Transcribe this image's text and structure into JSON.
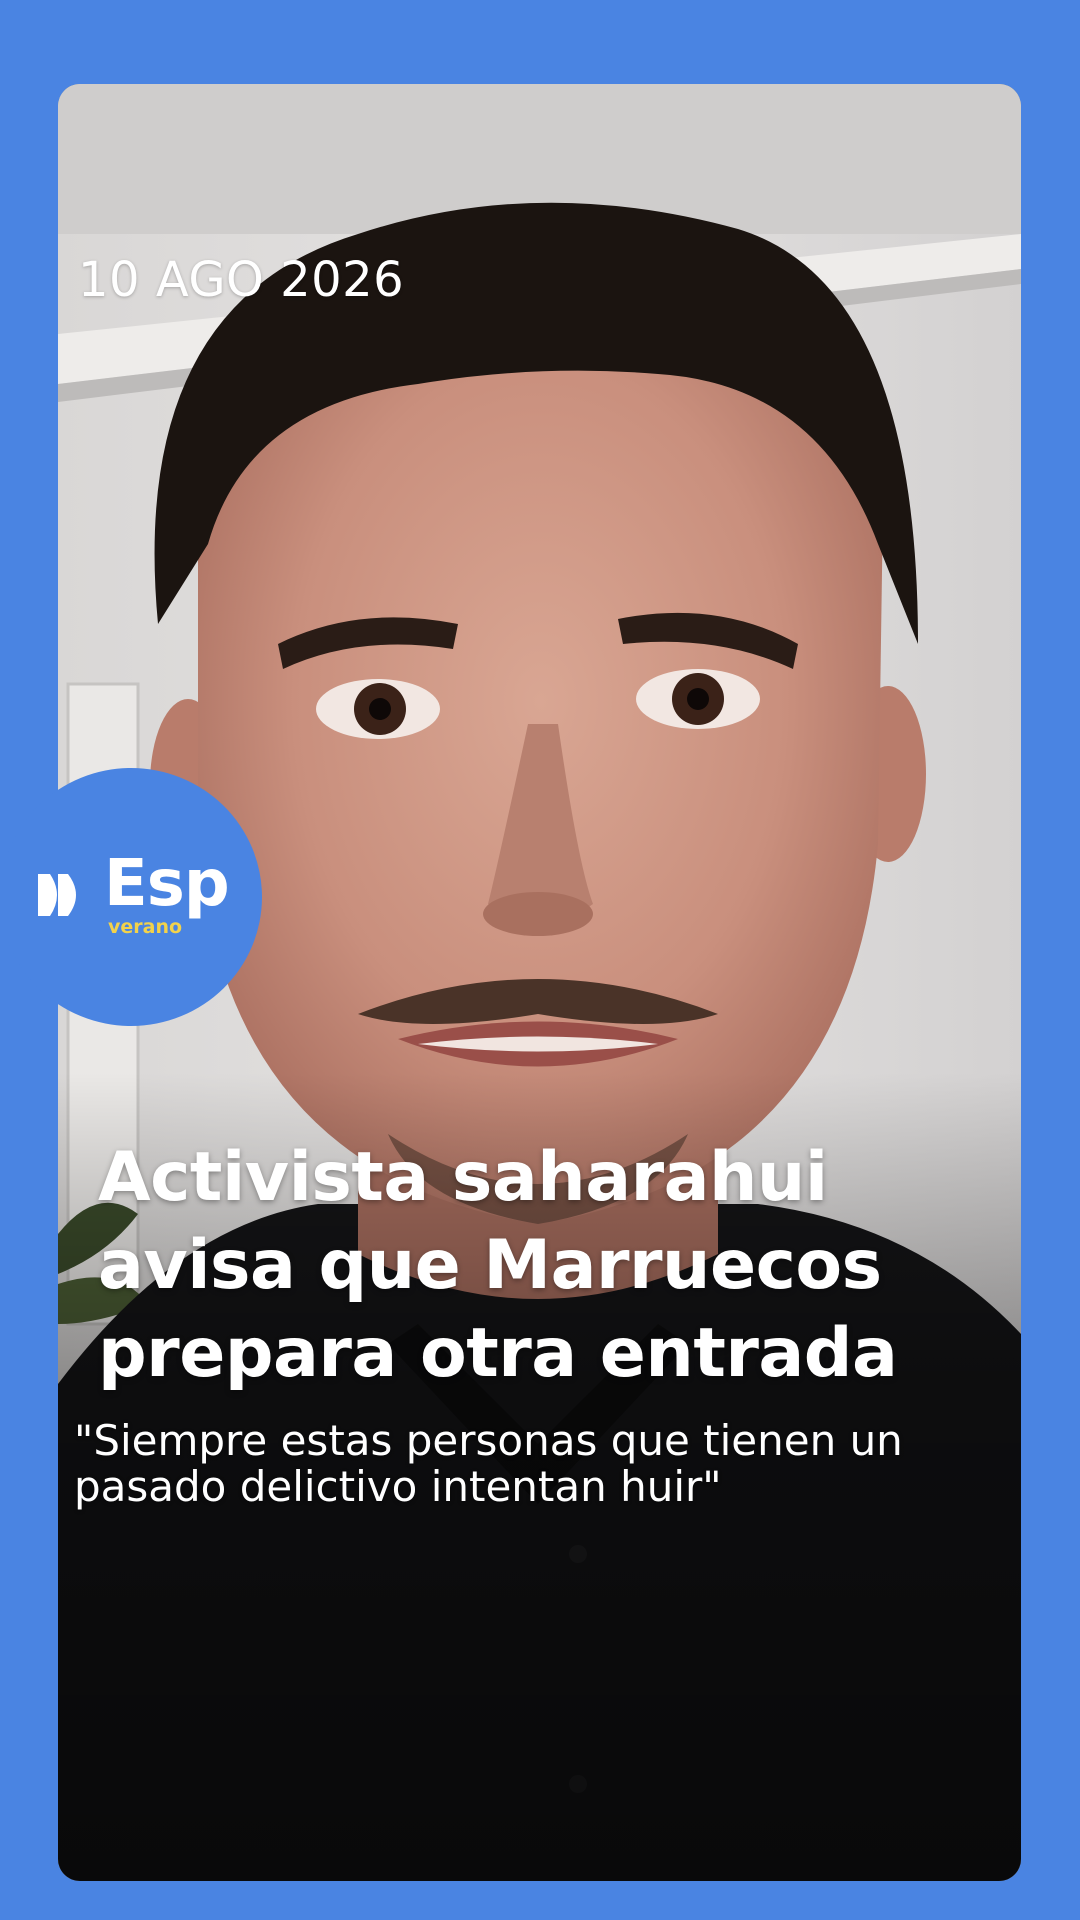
{
  "story": {
    "date": "10 AGO 2026",
    "headline": "Activista saharahui avisa que Marruecos prepara otra entrada",
    "quote": "\"Siempre estas personas que tienen un pasado delictivo intentan huir\""
  },
  "logo": {
    "wordmark": "Esp",
    "subtitle": "verano",
    "icon": "play-forward-icon"
  },
  "colors": {
    "background": "#4a84e2",
    "logo_badge": "#4a84e2",
    "logo_subtitle": "#f2d24b",
    "text": "#ffffff"
  }
}
